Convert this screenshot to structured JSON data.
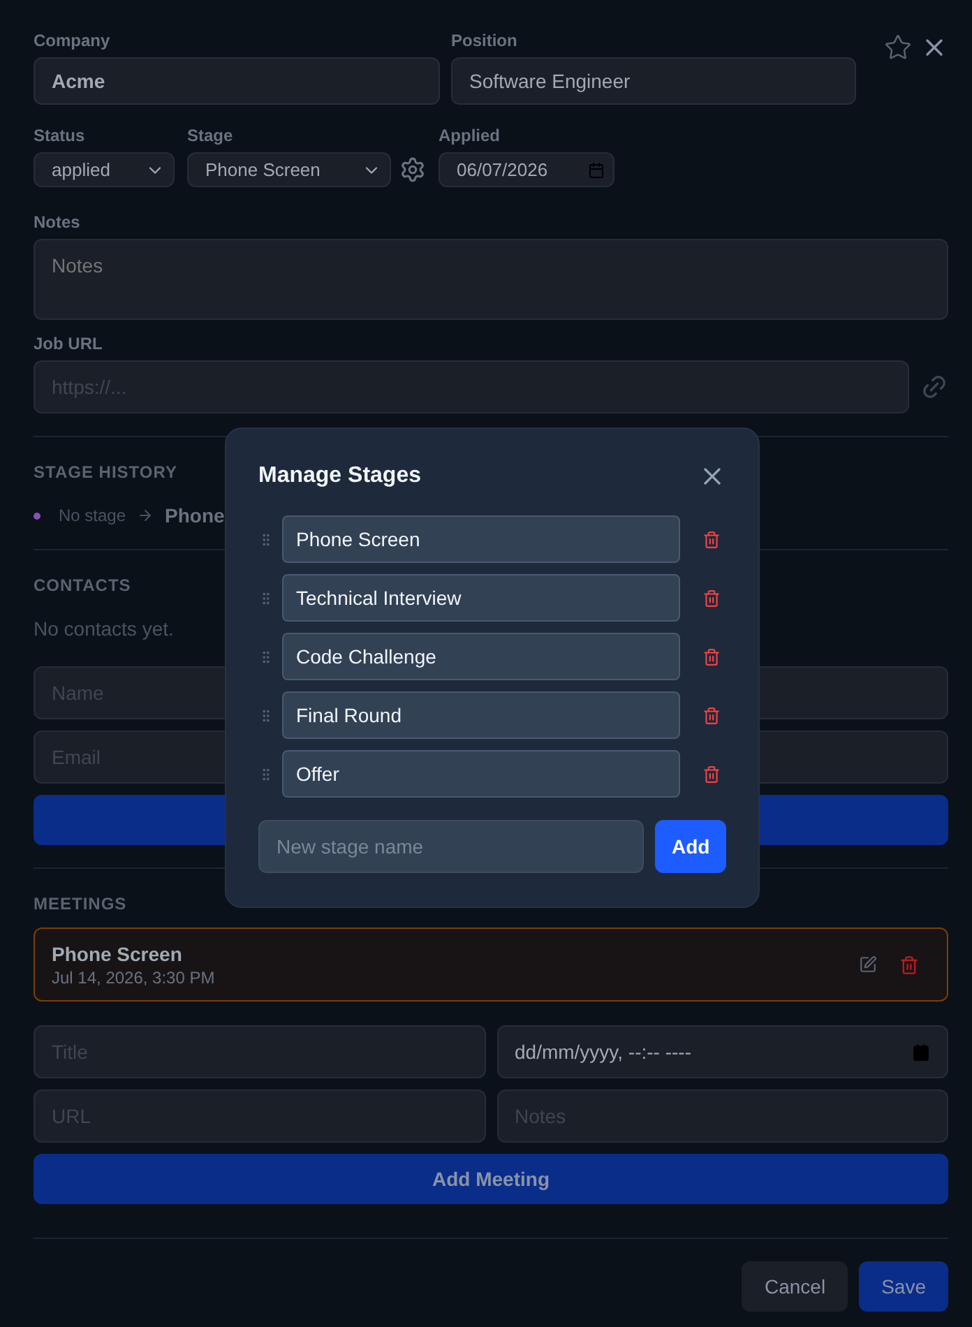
{
  "form": {
    "company": {
      "label": "Company",
      "value": "Acme"
    },
    "position": {
      "label": "Position",
      "value": "Software Engineer"
    },
    "starred": false,
    "status": {
      "label": "Status",
      "value": "applied"
    },
    "stage": {
      "label": "Stage",
      "value": "Phone Screen"
    },
    "applied": {
      "label": "Applied",
      "value": "06/07/2026"
    },
    "notes": {
      "label": "Notes",
      "placeholder": "Notes"
    },
    "job_url": {
      "label": "Job URL",
      "placeholder": "https://..."
    }
  },
  "stage_history": {
    "title": "STAGE HISTORY",
    "from": "No stage",
    "to": "Phone"
  },
  "contacts": {
    "title": "CONTACTS",
    "empty": "No contacts yet.",
    "fields": [
      {
        "placeholder": "Name"
      },
      {
        "placeholder": "Email"
      }
    ]
  },
  "meetings": {
    "title": "MEETINGS",
    "items": [
      {
        "title": "Phone Screen",
        "when": "Jul 14, 2026, 3:30 PM"
      }
    ],
    "fields": [
      {
        "kind": "text",
        "placeholder": "Title"
      },
      {
        "kind": "datetime",
        "value": "dd/mm/yyyy, --:-- ----"
      },
      {
        "kind": "text",
        "placeholder": "URL"
      },
      {
        "kind": "text",
        "placeholder": "Notes"
      }
    ],
    "add_button": "Add Meeting"
  },
  "footer": {
    "cancel": "Cancel",
    "save": "Save"
  },
  "modal": {
    "title": "Manage Stages",
    "stages": [
      "Phone Screen",
      "Technical Interview",
      "Code Challenge",
      "Final Round",
      "Offer"
    ],
    "new_placeholder": "New stage name",
    "add_button": "Add"
  }
}
